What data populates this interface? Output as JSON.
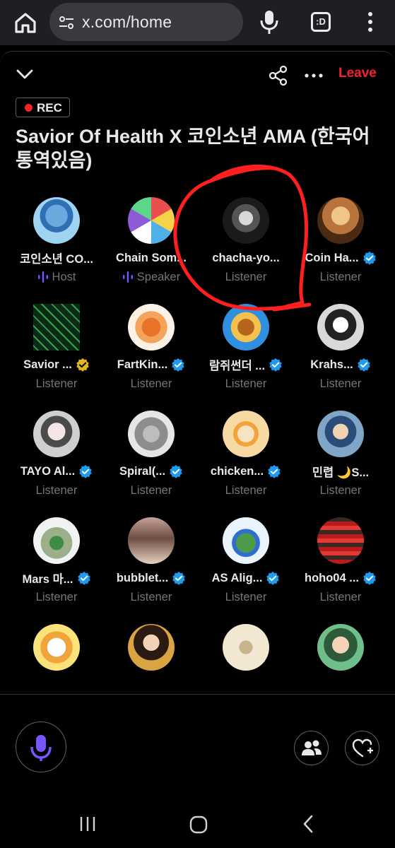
{
  "browser": {
    "url": "x.com/home",
    "tabs_label": ":D",
    "icons": [
      "home-icon",
      "tune-icon",
      "mic-icon",
      "tabs-icon",
      "more-vert-icon"
    ]
  },
  "header": {
    "leave_label": "Leave",
    "rec_label": "REC",
    "title": "Savior Of Health X 코인소년 AMA (한국어 통역있음)",
    "icons": [
      "chevron-down-icon",
      "share-icon",
      "more-horizontal-icon"
    ]
  },
  "colors": {
    "accent_red": "#f4212e",
    "verified_blue": "#1d9bf0",
    "verified_gold": "#e2b719",
    "speaker_purple": "#7856ff",
    "annotation_red": "#ff1f1f"
  },
  "participants": [
    {
      "name": "코인소년 CO...",
      "role": "Host",
      "verified": "none",
      "role_icon": "mic-waveform-icon"
    },
    {
      "name": "Chain Som...",
      "role": "Speaker",
      "verified": "none",
      "role_icon": "mic-waveform-icon"
    },
    {
      "name": "chacha-yo...",
      "role": "Listener",
      "verified": "none"
    },
    {
      "name": "Coin Ha...",
      "role": "Listener",
      "verified": "blue"
    },
    {
      "name": "Savior ...",
      "role": "Listener",
      "verified": "gold"
    },
    {
      "name": "FartKin...",
      "role": "Listener",
      "verified": "blue"
    },
    {
      "name": "람쥐썬더 ...",
      "role": "Listener",
      "verified": "blue"
    },
    {
      "name": "Krahs...",
      "role": "Listener",
      "verified": "blue"
    },
    {
      "name": "TAYO Al...",
      "role": "Listener",
      "verified": "blue"
    },
    {
      "name": "Spiral(...",
      "role": "Listener",
      "verified": "blue"
    },
    {
      "name": "chicken...",
      "role": "Listener",
      "verified": "blue"
    },
    {
      "name": "민렵 🌙S...",
      "role": "Listener",
      "verified": "none"
    },
    {
      "name": "Mars 마...",
      "role": "Listener",
      "verified": "blue"
    },
    {
      "name": "bubblet...",
      "role": "Listener",
      "verified": "blue"
    },
    {
      "name": "AS Alig...",
      "role": "Listener",
      "verified": "blue"
    },
    {
      "name": "hoho04 ...",
      "role": "Listener",
      "verified": "blue"
    },
    {
      "name": "",
      "role": "",
      "verified": "none"
    },
    {
      "name": "",
      "role": "",
      "verified": "none"
    },
    {
      "name": "",
      "role": "",
      "verified": "none"
    },
    {
      "name": "",
      "role": "",
      "verified": "none"
    }
  ],
  "footer": {
    "icons": [
      "mic-icon",
      "people-icon",
      "heart-plus-icon"
    ]
  },
  "system_nav": {
    "icons": [
      "recent-apps-icon",
      "home-circle-icon",
      "back-icon"
    ]
  }
}
